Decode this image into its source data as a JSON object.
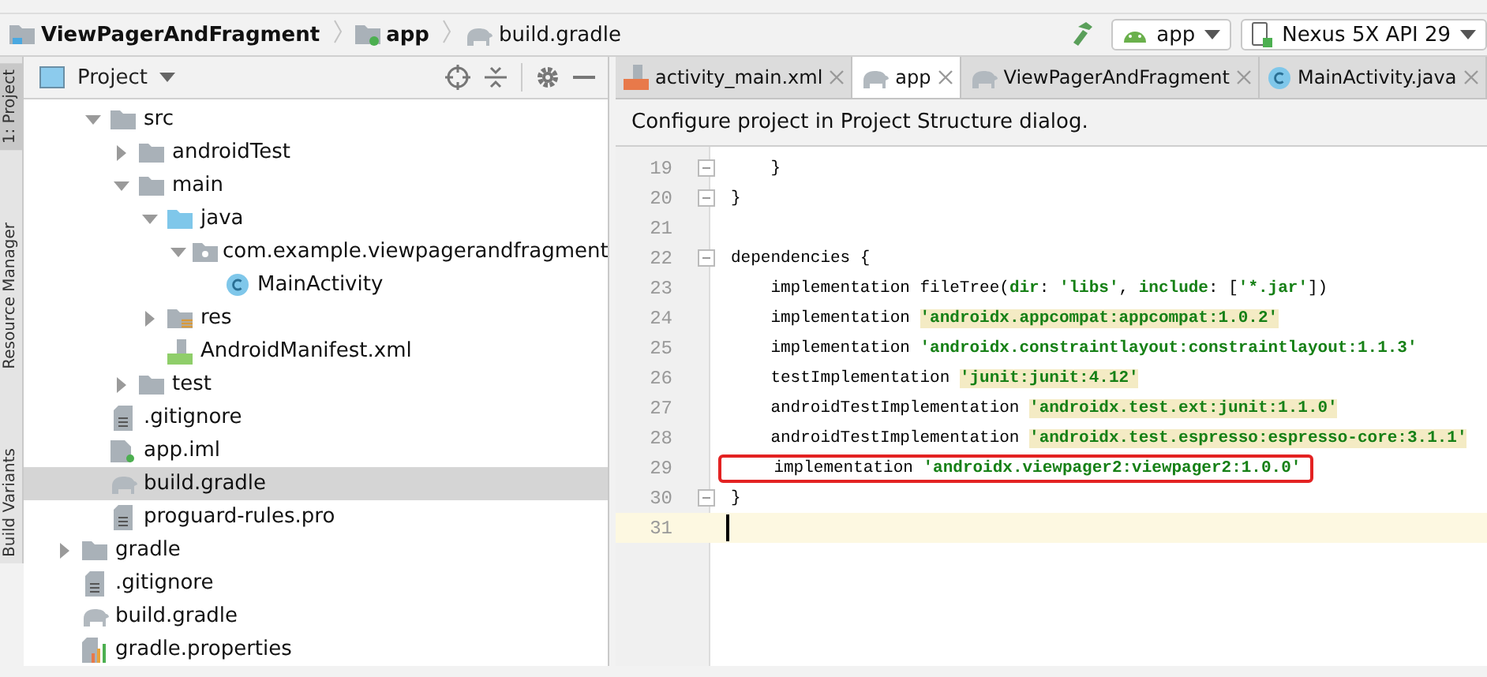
{
  "breadcrumbs": [
    {
      "label": "ViewPagerAndFragment",
      "kind": "project"
    },
    {
      "label": "app",
      "kind": "module"
    },
    {
      "label": "build.gradle",
      "kind": "gradle"
    }
  ],
  "run_toolbar": {
    "configuration": "app",
    "device": "Nexus 5X API 29"
  },
  "side_strip": [
    {
      "label": "1: Project",
      "selected": true
    },
    {
      "label": "Resource Manager",
      "selected": false
    },
    {
      "label": "Build Variants",
      "selected": false
    }
  ],
  "project_panel": {
    "title": "Project",
    "tree": {
      "app_module_items": [
        {
          "label": "src",
          "kind": "folder",
          "expanded": true,
          "selected": false,
          "children": [
            {
              "label": "androidTest",
              "kind": "folder",
              "expanded": false,
              "selected": false
            },
            {
              "label": "main",
              "kind": "folder",
              "expanded": true,
              "selected": false,
              "children": [
                {
                  "label": "java",
                  "kind": "source_folder",
                  "expanded": true,
                  "selected": false,
                  "children": [
                    {
                      "label": "com.example.viewpagerandfragment",
                      "kind": "package",
                      "expanded": true,
                      "selected": false,
                      "children": [
                        {
                          "label": "MainActivity",
                          "kind": "class",
                          "selected": false
                        }
                      ]
                    }
                  ]
                },
                {
                  "label": "res",
                  "kind": "res_folder",
                  "expanded": false,
                  "selected": false
                },
                {
                  "label": "AndroidManifest.xml",
                  "kind": "manifest",
                  "selected": false
                }
              ]
            },
            {
              "label": "test",
              "kind": "folder",
              "expanded": false,
              "selected": false
            }
          ]
        },
        {
          "label": ".gitignore",
          "kind": "text_file",
          "selected": false
        },
        {
          "label": "app.iml",
          "kind": "module_file",
          "selected": false
        },
        {
          "label": "build.gradle",
          "kind": "gradle",
          "selected": true
        },
        {
          "label": "proguard-rules.pro",
          "kind": "text_file",
          "selected": false
        }
      ],
      "items": [
        {
          "label": "gradle",
          "kind": "folder",
          "expanded": false,
          "selected": false
        },
        {
          "label": ".gitignore",
          "kind": "text_file",
          "selected": false
        },
        {
          "label": "build.gradle",
          "kind": "gradle",
          "selected": false
        },
        {
          "label": "gradle.properties",
          "kind": "properties",
          "selected": false
        }
      ]
    }
  },
  "editor_tabs": [
    {
      "label": "activity_main.xml",
      "kind": "xml",
      "selected": false
    },
    {
      "label": "app",
      "kind": "gradle",
      "selected": true
    },
    {
      "label": "ViewPagerAndFragment",
      "kind": "gradle",
      "selected": false
    },
    {
      "label": "MainActivity.java",
      "kind": "class",
      "selected": false
    }
  ],
  "notification": "Configure project in Project Structure dialog.",
  "code_lines": [
    {
      "number": "19",
      "fold": true,
      "segments": [
        {
          "text": "    }",
          "kind": "plain"
        }
      ]
    },
    {
      "number": "20",
      "fold": true,
      "segments": [
        {
          "text": "}",
          "kind": "plain"
        }
      ]
    },
    {
      "number": "21"
    },
    {
      "number": "22",
      "fold": true,
      "segments": [
        {
          "text": "dependencies {",
          "kind": "plain"
        }
      ]
    },
    {
      "number": "23",
      "segments": [
        {
          "text": "    implementation fileTree(",
          "kind": "plain"
        },
        {
          "text": "dir",
          "kind": "string"
        },
        {
          "text": ": ",
          "kind": "plain"
        },
        {
          "text": "'libs'",
          "kind": "string"
        },
        {
          "text": ", ",
          "kind": "plain"
        },
        {
          "text": "include",
          "kind": "string"
        },
        {
          "text": ": [",
          "kind": "plain"
        },
        {
          "text": "'*.jar'",
          "kind": "string"
        },
        {
          "text": "])",
          "kind": "plain"
        }
      ]
    },
    {
      "number": "24",
      "segments": [
        {
          "text": "    implementation ",
          "kind": "plain"
        },
        {
          "text": "'androidx.appcompat:appcompat:1.0.2'",
          "kind": "highlighted_string"
        }
      ]
    },
    {
      "number": "25",
      "segments": [
        {
          "text": "    implementation ",
          "kind": "plain"
        },
        {
          "text": "'androidx.constraintlayout:constraintlayout:1.1.3'",
          "kind": "string"
        }
      ]
    },
    {
      "number": "26",
      "segments": [
        {
          "text": "    testImplementation ",
          "kind": "plain"
        },
        {
          "text": "'junit:junit:4.12'",
          "kind": "highlighted_string"
        }
      ]
    },
    {
      "number": "27",
      "segments": [
        {
          "text": "    androidTestImplementation ",
          "kind": "plain"
        },
        {
          "text": "'androidx.test.ext:junit:1.1.0'",
          "kind": "highlighted_string"
        }
      ]
    },
    {
      "number": "28",
      "segments": [
        {
          "text": "    androidTestImplementation ",
          "kind": "plain"
        },
        {
          "text": "'androidx.test.espresso:espresso-core:3.1.1'",
          "kind": "highlighted_string"
        }
      ]
    },
    {
      "number": "29",
      "boxed": true,
      "segments": [
        {
          "text": "    implementation ",
          "kind": "plain"
        },
        {
          "text": "'androidx.viewpager2:viewpager2:1.0.0'",
          "kind": "string"
        }
      ]
    },
    {
      "number": "30",
      "fold": true,
      "segments": [
        {
          "text": "}",
          "kind": "plain"
        }
      ]
    },
    {
      "number": "31",
      "current": true
    }
  ]
}
